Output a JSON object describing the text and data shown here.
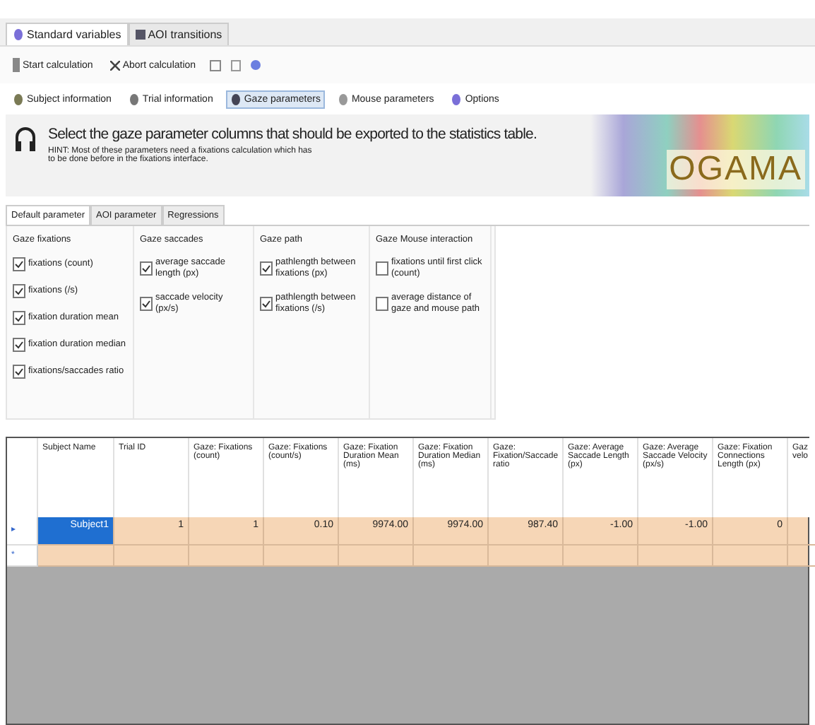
{
  "top_tabs": [
    {
      "label": "Standard variables",
      "selected": true
    },
    {
      "label": "AOI transitions",
      "selected": false
    }
  ],
  "toolbar": {
    "buttons": [
      {
        "label": "Start calculation",
        "kind": "start"
      },
      {
        "label": "Abort calculation",
        "kind": "abort"
      }
    ]
  },
  "section_tabs": [
    {
      "label": "Subject information",
      "selected": false
    },
    {
      "label": "Trial information",
      "selected": false
    },
    {
      "label": "Gaze parameters",
      "selected": true
    },
    {
      "label": "Mouse parameters",
      "selected": false
    },
    {
      "label": "Options",
      "selected": false
    }
  ],
  "header": {
    "title": "Select the gaze parameter columns that should be exported to the statistics table.",
    "hint": "HINT: Most of these parameters need a fixations calculation which has to be done before in the fixations interface.",
    "logo": "OGAMA"
  },
  "param_tabs": [
    {
      "label": "Default parameter",
      "selected": true
    },
    {
      "label": "AOI parameter",
      "selected": false
    },
    {
      "label": "Regressions",
      "selected": false
    }
  ],
  "groups": [
    {
      "title": "Gaze fixations",
      "options": [
        {
          "label": "fixations (count)",
          "checked": true
        },
        {
          "label": "fixations (/s)",
          "checked": true
        },
        {
          "label": "fixation duration mean",
          "checked": true
        },
        {
          "label": "fixation duration median",
          "checked": true
        },
        {
          "label": "fixations/saccades ratio",
          "checked": true
        }
      ]
    },
    {
      "title": "Gaze saccades",
      "options": [
        {
          "label": "average saccade length (px)",
          "checked": true
        },
        {
          "label": "saccade velocity (px/s)",
          "checked": true
        }
      ]
    },
    {
      "title": "Gaze path",
      "options": [
        {
          "label": "pathlength between fixations (px)",
          "checked": true
        },
        {
          "label": "pathlength between fixations (/s)",
          "checked": true
        }
      ]
    },
    {
      "title": "Gaze Mouse interaction",
      "options": [
        {
          "label": "fixations until first click (count)",
          "checked": false
        },
        {
          "label": "average distance of gaze and mouse path",
          "checked": false
        }
      ]
    }
  ],
  "table": {
    "columns": [
      "Subject Name",
      "Trial ID",
      "Gaze: Fixations (count)",
      "Gaze: Fixations (count/s)",
      "Gaze: Fixation Duration Mean (ms)",
      "Gaze: Fixation Duration Median (ms)",
      "Gaze: Fixation/Saccade ratio",
      "Gaze: Average Saccade Length (px)",
      "Gaze: Average Saccade Velocity (px/s)",
      "Gaze: Fixation Connections Length (px)",
      "Gaz velo"
    ],
    "rows": [
      {
        "marker": "▸",
        "selected": true,
        "cells": [
          "Subject1",
          "1",
          "1",
          "0.10",
          "9974.00",
          "9974.00",
          "987.40",
          "-1.00",
          "-1.00",
          "0",
          ""
        ]
      },
      {
        "marker": "*",
        "selected": false,
        "cells": [
          "",
          "",
          "",
          "",
          "",
          "",
          "",
          "",
          "",
          "",
          ""
        ]
      }
    ]
  }
}
